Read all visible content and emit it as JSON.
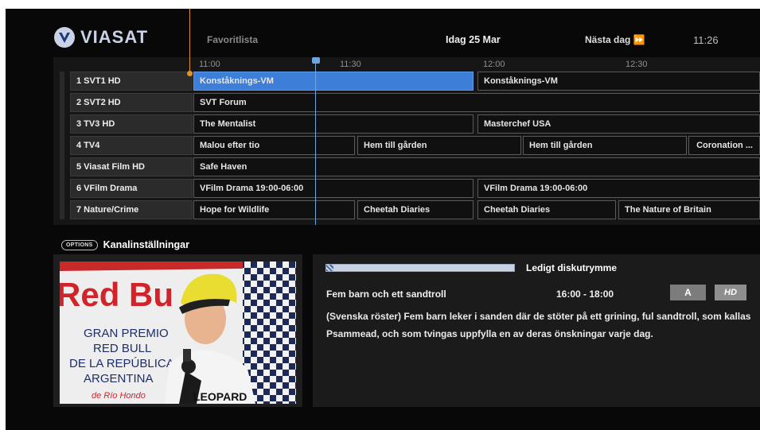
{
  "header": {
    "brand": "VIASAT",
    "favorites": "Favoritlista",
    "date": "Idag 25 Mar",
    "next_day": "Nästa dag ⏩",
    "clock": "11:26"
  },
  "timeline": [
    "11:00",
    "11:30",
    "12:00",
    "12:30"
  ],
  "channels": [
    {
      "name": "1 SVT1 HD",
      "programs": [
        "Konståknings-VM",
        "Konståknings-VM"
      ]
    },
    {
      "name": "2 SVT2 HD",
      "programs": [
        "SVT Forum"
      ]
    },
    {
      "name": "3 TV3 HD",
      "programs": [
        "The Mentalist",
        "Masterchef USA"
      ]
    },
    {
      "name": "4 TV4",
      "programs": [
        "Malou efter tio",
        "Hem till gården",
        "Hem till gården",
        "Coronation ..."
      ]
    },
    {
      "name": "5 Viasat Film HD",
      "programs": [
        "Safe Haven"
      ]
    },
    {
      "name": "6 VFilm Drama",
      "programs": [
        "VFilm Drama 19:00-06:00",
        "VFilm Drama 19:00-06:00"
      ]
    },
    {
      "name": "7 Nature/Crime",
      "programs": [
        "Hope for Wildlife",
        "Cheetah Diaries",
        "Cheetah Diaries",
        "The Nature of Britain"
      ]
    }
  ],
  "options": {
    "button": "OPTIONS",
    "label": "Kanalinställningar"
  },
  "preview": {
    "sign_lines": [
      "Red Bu",
      "GRAN PREMIO",
      "RED BULL",
      "DE LA REPÚBLICA",
      "ARGENTINA",
      "de Río Hondo"
    ],
    "jacket_text": "LEOPARD"
  },
  "info": {
    "disk_label": "Ledigt diskutrymme",
    "disk_used_fraction": 0.04,
    "title": "Fem barn och ett sandtroll",
    "time": "16:00 - 18:00",
    "badge_age": "A",
    "badge_hd": "HD",
    "description": "(Svenska röster) Fem barn leker i sanden där de stöter på ett grining, ful sandtroll, som kallas Psammead, och som tvingas uppfylla en av deras önskningar varje dag."
  },
  "colors": {
    "accent": "#3d7fd8",
    "now_line": "#6fa5df",
    "favorite": "#e0507a",
    "annotation": "#e0922b"
  }
}
